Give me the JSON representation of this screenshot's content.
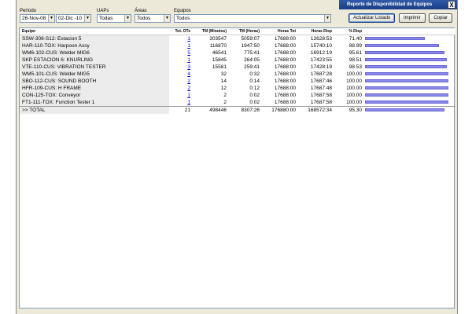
{
  "window": {
    "title": "Reporte de Disponibilidad de Equipos",
    "close_label": "X"
  },
  "filters": {
    "periodo_label": "Período",
    "periodo_from": "26-Nov-08",
    "periodo_to": "02-Dic -10",
    "uaps_label": "UAPs",
    "uaps_value": "Todas",
    "areas_label": "Áreas",
    "areas_value": "Todos",
    "equipos_label": "Equipos",
    "equipos_value": "Todos"
  },
  "buttons": {
    "actualizar": "Actualizar Listado",
    "imprimir": "Imprimir",
    "copiar": "Copiar"
  },
  "table": {
    "headers": [
      "Equipo",
      "Tot. OTs",
      "TM (Minutos)",
      "TM (Horas)",
      "Horas Tot",
      "Horas Disp",
      "% Disp"
    ],
    "rows": [
      {
        "equipo": "SSW-308-S12: Estacion 5",
        "ots": "1",
        "tm_min": "303547",
        "tm_h": "5059:07",
        "horas_tot": "17688:00",
        "horas_disp": "12628:53",
        "disp": "71.40",
        "pct": 71.4
      },
      {
        "equipo": "HAR-110-TOX: Harpoon Assy",
        "ots": "1",
        "tm_min": "116870",
        "tm_h": "1947:50",
        "horas_tot": "17688:00",
        "horas_disp": "15740:10",
        "disp": "88.99",
        "pct": 88.99
      },
      {
        "equipo": "WM6-102-CUS: Welder MIG6",
        "ots": "5",
        "tm_min": "46541",
        "tm_h": "775:41",
        "horas_tot": "17688:00",
        "horas_disp": "16912:19",
        "disp": "95.61",
        "pct": 95.61
      },
      {
        "equipo": "SKP ESTACION 6: KNURLING",
        "ots": "1",
        "tm_min": "15845",
        "tm_h": "264:05",
        "horas_tot": "17688:00",
        "horas_disp": "17423:55",
        "disp": "98.51",
        "pct": 98.51
      },
      {
        "equipo": "VTE-110-CUS: VIBRATION TESTER",
        "ots": "3",
        "tm_min": "15581",
        "tm_h": "259:41",
        "horas_tot": "17688:00",
        "horas_disp": "17428:19",
        "disp": "98.53",
        "pct": 98.53
      },
      {
        "equipo": "WM5-101-CUS: Welder MIG5",
        "ots": "4",
        "tm_min": "32",
        "tm_h": "0:32",
        "horas_tot": "17688:00",
        "horas_disp": "17687:28",
        "disp": "100.00",
        "pct": 100.0
      },
      {
        "equipo": "SBO-112-CUS: SOUND BOOTH",
        "ots": "2",
        "tm_min": "14",
        "tm_h": "0:14",
        "horas_tot": "17688:00",
        "horas_disp": "17687:46",
        "disp": "100.00",
        "pct": 100.0
      },
      {
        "equipo": "HFR-109-CUS: H FRAME",
        "ots": "2",
        "tm_min": "12",
        "tm_h": "0:12",
        "horas_tot": "17688:00",
        "horas_disp": "17687:48",
        "disp": "100.00",
        "pct": 100.0
      },
      {
        "equipo": "CON-125-TOX: Conveyor",
        "ots": "1",
        "tm_min": "2",
        "tm_h": "0:02",
        "horas_tot": "17688:00",
        "horas_disp": "17687:58",
        "disp": "100.00",
        "pct": 100.0
      },
      {
        "equipo": "FT1-111-TOX: Function Tester 1",
        "ots": "1",
        "tm_min": "2",
        "tm_h": "0:02",
        "horas_tot": "17688:00",
        "horas_disp": "17687:58",
        "disp": "100.00",
        "pct": 100.0
      }
    ],
    "total": {
      "equipo": ">> TOTAL",
      "ots": "21",
      "tm_min": "498446",
      "tm_h": "8307:26",
      "horas_tot": "176880:00",
      "horas_disp": "168572:34",
      "disp": "95.30",
      "pct": 95.3
    }
  },
  "colors": {
    "bar_fill": "#8a88e6",
    "titlebar": "#1a3e86"
  }
}
